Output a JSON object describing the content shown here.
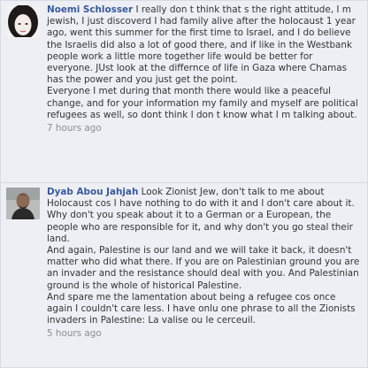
{
  "comments": [
    {
      "author": "Noemi Schlosser",
      "avatar_icon": "profile-photo-icon",
      "paragraphs": [
        "I really don t think that s the right attitude, I m jewish, I just discoverd I had family alive after the holocaust 1 year ago, went this summer for the first time to Israel, and I do believe the Israelis did also a lot of good there, and if like in the Westbank people work a little more together life would be better for everyone. JUst look at the differnce of life in Gaza where Chamas has the power and you just get the point.",
        "Everyone I met during that month there would like a peaceful change, and for your information my family and myself are political refugees as well, so dont think I don t know what I m talking about."
      ],
      "timestamp": "7 hours ago"
    },
    {
      "author": "Dyab Abou Jahjah",
      "avatar_icon": "profile-photo-icon",
      "paragraphs": [
        "Look Zionist Jew, don't talk to me about Holocaust cos I have nothing to do with it and I don't care about it. Why don't you speak about it to a German or a European, the people who are responsible for it, and why don't you go steal their land.",
        "And again, Palestine is our land and we will take it back, it doesn't matter who did what there. If you are on Palestinian ground you are an invader and the resistance should deal with you. And Palestinian ground is the whole of historical Palestine.",
        "And spare me the lamentation about being a refugee cos once again I couldn't care less. I have onlu one phrase to all the Zionists invaders in Palestine: La valise ou le cerceuil."
      ],
      "timestamp": "5 hours ago"
    }
  ]
}
